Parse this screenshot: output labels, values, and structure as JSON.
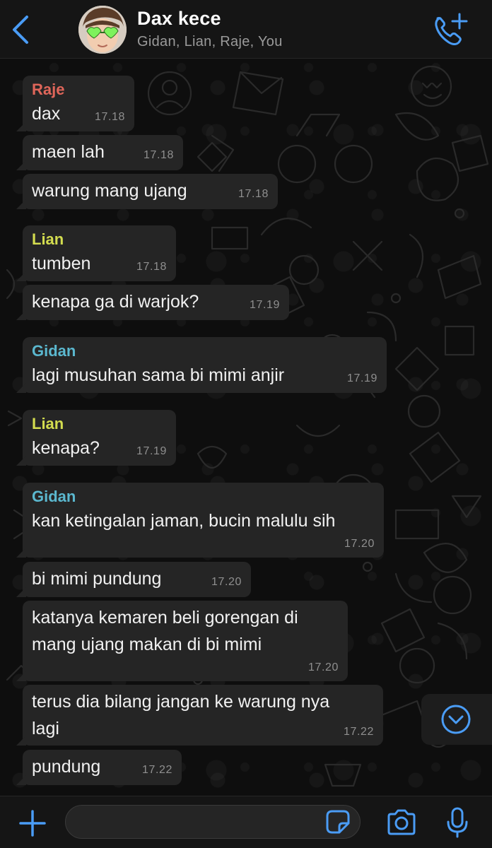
{
  "header": {
    "title": "Dax kece",
    "members": "Gidan, Lian, Raje, You",
    "back_icon": "chevron-left-icon",
    "call_icon": "add-call-icon"
  },
  "colors": {
    "accent": "#4a9cf5",
    "raje": "#e0665a",
    "lian": "#d3dc4f",
    "gidan": "#5bb8cf",
    "bubble": "#252525"
  },
  "messages": [
    {
      "sender": "Raje",
      "text": "dax",
      "time": "17.18"
    },
    {
      "text": "maen lah",
      "time": "17.18"
    },
    {
      "text": "warung mang ujang",
      "time": "17.18"
    },
    {
      "sender": "Lian",
      "text": "tumben",
      "time": "17.18"
    },
    {
      "text": "kenapa ga di warjok?",
      "time": "17.19"
    },
    {
      "sender": "Gidan",
      "text": "lagi musuhan sama bi mimi anjir",
      "time": "17.19"
    },
    {
      "sender": "Lian",
      "text": "kenapa?",
      "time": "17.19"
    },
    {
      "sender": "Gidan",
      "text": "kan ketingalan jaman, bucin malulu sih",
      "time": "17.20"
    },
    {
      "text": "bi mimi pundung",
      "time": "17.20"
    },
    {
      "text": "katanya kemaren beli gorengan di\nmang ujang makan di bi mimi",
      "time": "17.20"
    },
    {
      "text": "terus dia bilang jangan ke warung nya\nlagi",
      "time": "17.22"
    },
    {
      "text": "pundung",
      "time": "17.22"
    }
  ],
  "composer": {
    "input_value": "",
    "icons": [
      "plus-icon",
      "sticker-icon",
      "camera-icon",
      "microphone-icon"
    ]
  },
  "scroll_button_icon": "chevron-down-circle-icon"
}
